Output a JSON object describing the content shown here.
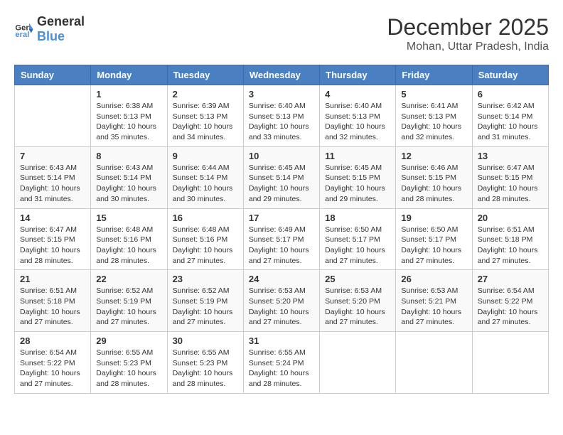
{
  "header": {
    "logo_general": "General",
    "logo_blue": "Blue",
    "month": "December 2025",
    "location": "Mohan, Uttar Pradesh, India"
  },
  "days_of_week": [
    "Sunday",
    "Monday",
    "Tuesday",
    "Wednesday",
    "Thursday",
    "Friday",
    "Saturday"
  ],
  "weeks": [
    [
      {
        "day": "",
        "info": ""
      },
      {
        "day": "1",
        "info": "Sunrise: 6:38 AM\nSunset: 5:13 PM\nDaylight: 10 hours\nand 35 minutes."
      },
      {
        "day": "2",
        "info": "Sunrise: 6:39 AM\nSunset: 5:13 PM\nDaylight: 10 hours\nand 34 minutes."
      },
      {
        "day": "3",
        "info": "Sunrise: 6:40 AM\nSunset: 5:13 PM\nDaylight: 10 hours\nand 33 minutes."
      },
      {
        "day": "4",
        "info": "Sunrise: 6:40 AM\nSunset: 5:13 PM\nDaylight: 10 hours\nand 32 minutes."
      },
      {
        "day": "5",
        "info": "Sunrise: 6:41 AM\nSunset: 5:13 PM\nDaylight: 10 hours\nand 32 minutes."
      },
      {
        "day": "6",
        "info": "Sunrise: 6:42 AM\nSunset: 5:14 PM\nDaylight: 10 hours\nand 31 minutes."
      }
    ],
    [
      {
        "day": "7",
        "info": "Sunrise: 6:43 AM\nSunset: 5:14 PM\nDaylight: 10 hours\nand 31 minutes."
      },
      {
        "day": "8",
        "info": "Sunrise: 6:43 AM\nSunset: 5:14 PM\nDaylight: 10 hours\nand 30 minutes."
      },
      {
        "day": "9",
        "info": "Sunrise: 6:44 AM\nSunset: 5:14 PM\nDaylight: 10 hours\nand 30 minutes."
      },
      {
        "day": "10",
        "info": "Sunrise: 6:45 AM\nSunset: 5:14 PM\nDaylight: 10 hours\nand 29 minutes."
      },
      {
        "day": "11",
        "info": "Sunrise: 6:45 AM\nSunset: 5:15 PM\nDaylight: 10 hours\nand 29 minutes."
      },
      {
        "day": "12",
        "info": "Sunrise: 6:46 AM\nSunset: 5:15 PM\nDaylight: 10 hours\nand 28 minutes."
      },
      {
        "day": "13",
        "info": "Sunrise: 6:47 AM\nSunset: 5:15 PM\nDaylight: 10 hours\nand 28 minutes."
      }
    ],
    [
      {
        "day": "14",
        "info": "Sunrise: 6:47 AM\nSunset: 5:15 PM\nDaylight: 10 hours\nand 28 minutes."
      },
      {
        "day": "15",
        "info": "Sunrise: 6:48 AM\nSunset: 5:16 PM\nDaylight: 10 hours\nand 28 minutes."
      },
      {
        "day": "16",
        "info": "Sunrise: 6:48 AM\nSunset: 5:16 PM\nDaylight: 10 hours\nand 27 minutes."
      },
      {
        "day": "17",
        "info": "Sunrise: 6:49 AM\nSunset: 5:17 PM\nDaylight: 10 hours\nand 27 minutes."
      },
      {
        "day": "18",
        "info": "Sunrise: 6:50 AM\nSunset: 5:17 PM\nDaylight: 10 hours\nand 27 minutes."
      },
      {
        "day": "19",
        "info": "Sunrise: 6:50 AM\nSunset: 5:17 PM\nDaylight: 10 hours\nand 27 minutes."
      },
      {
        "day": "20",
        "info": "Sunrise: 6:51 AM\nSunset: 5:18 PM\nDaylight: 10 hours\nand 27 minutes."
      }
    ],
    [
      {
        "day": "21",
        "info": "Sunrise: 6:51 AM\nSunset: 5:18 PM\nDaylight: 10 hours\nand 27 minutes."
      },
      {
        "day": "22",
        "info": "Sunrise: 6:52 AM\nSunset: 5:19 PM\nDaylight: 10 hours\nand 27 minutes."
      },
      {
        "day": "23",
        "info": "Sunrise: 6:52 AM\nSunset: 5:19 PM\nDaylight: 10 hours\nand 27 minutes."
      },
      {
        "day": "24",
        "info": "Sunrise: 6:53 AM\nSunset: 5:20 PM\nDaylight: 10 hours\nand 27 minutes."
      },
      {
        "day": "25",
        "info": "Sunrise: 6:53 AM\nSunset: 5:20 PM\nDaylight: 10 hours\nand 27 minutes."
      },
      {
        "day": "26",
        "info": "Sunrise: 6:53 AM\nSunset: 5:21 PM\nDaylight: 10 hours\nand 27 minutes."
      },
      {
        "day": "27",
        "info": "Sunrise: 6:54 AM\nSunset: 5:22 PM\nDaylight: 10 hours\nand 27 minutes."
      }
    ],
    [
      {
        "day": "28",
        "info": "Sunrise: 6:54 AM\nSunset: 5:22 PM\nDaylight: 10 hours\nand 27 minutes."
      },
      {
        "day": "29",
        "info": "Sunrise: 6:55 AM\nSunset: 5:23 PM\nDaylight: 10 hours\nand 28 minutes."
      },
      {
        "day": "30",
        "info": "Sunrise: 6:55 AM\nSunset: 5:23 PM\nDaylight: 10 hours\nand 28 minutes."
      },
      {
        "day": "31",
        "info": "Sunrise: 6:55 AM\nSunset: 5:24 PM\nDaylight: 10 hours\nand 28 minutes."
      },
      {
        "day": "",
        "info": ""
      },
      {
        "day": "",
        "info": ""
      },
      {
        "day": "",
        "info": ""
      }
    ]
  ]
}
